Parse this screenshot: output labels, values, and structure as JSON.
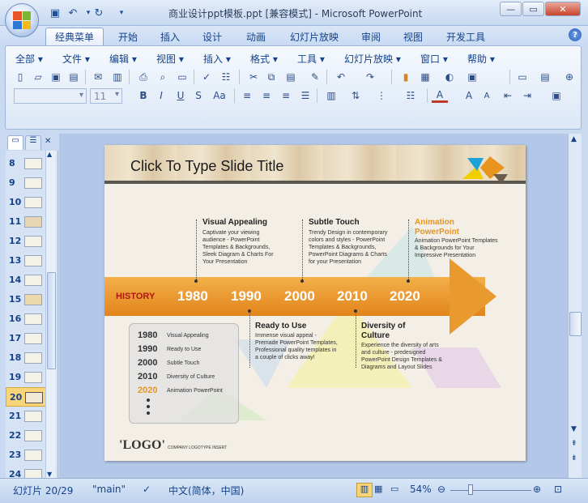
{
  "window": {
    "title": "商业设计ppt模板.ppt [兼容模式] - Microsoft PowerPoint",
    "minimize": "—",
    "restore": "▭",
    "close": "✕"
  },
  "qat": {
    "save_icon": "save-icon",
    "undo_icon": "undo-icon",
    "redo_icon": "redo-icon"
  },
  "tabs": [
    "经典菜单",
    "开始",
    "插入",
    "设计",
    "动画",
    "幻灯片放映",
    "审阅",
    "视图",
    "开发工具"
  ],
  "menus": [
    "全部",
    "文件",
    "编辑",
    "视图",
    "插入",
    "格式",
    "工具",
    "幻灯片放映",
    "窗口",
    "帮助"
  ],
  "font": {
    "name": "",
    "size": "11"
  },
  "thumbnails": [
    "8",
    "9",
    "10",
    "11",
    "12",
    "13",
    "14",
    "15",
    "16",
    "17",
    "18",
    "19",
    "20",
    "21",
    "22",
    "23",
    "24"
  ],
  "selected_thumbnail": "20",
  "slide": {
    "title": "Click To Type Slide Title",
    "history": "HISTORY",
    "years": [
      "1980",
      "1990",
      "2000",
      "2010",
      "2020"
    ],
    "top_annotations": [
      {
        "heading": "Visual Appealing",
        "text": "Captivate your viewing audience - PowerPoint Templates & Backgrounds, Sleek Diagram & Charts For Your Presentation"
      },
      {
        "heading": "Subtle Touch",
        "text": "Trendy Design in contemporary colors and styles - PowerPoint Templates & Backgrounds, PowerPoint Diagrams & Charts for your Presentation"
      },
      {
        "heading": "Animation PowerPoint",
        "text": "Animation PowerPoint Templates & Backgrounds for Your Impressive Presentation"
      }
    ],
    "bottom_annotations": [
      {
        "heading": "Ready to Use",
        "text": "Immense visual appeal - Premade PowerPoint Templates, Professional quality templates in a couple of clicks away!"
      },
      {
        "heading": "Diversity of Culture",
        "text": "Experience the diversity of arts and culture - predesigned PowerPoint Design Templates & Diagrams and Layout Slides"
      }
    ],
    "legend": [
      {
        "year": "1980",
        "label": "Visual Appealing"
      },
      {
        "year": "1990",
        "label": "Ready to Use"
      },
      {
        "year": "2000",
        "label": "Subtle Touch"
      },
      {
        "year": "2010",
        "label": "Diversity of Culture"
      },
      {
        "year": "2020",
        "label": "Animation PowerPoint"
      }
    ],
    "logo": "'LOGO'",
    "logo_sub": "COMPANY LOGOTYPE INSERT",
    "accent": "#e8941f"
  },
  "status": {
    "slide": "幻灯片 20/29",
    "theme": "\"main\"",
    "language": "中文(简体，中国)",
    "zoom": "54%"
  }
}
